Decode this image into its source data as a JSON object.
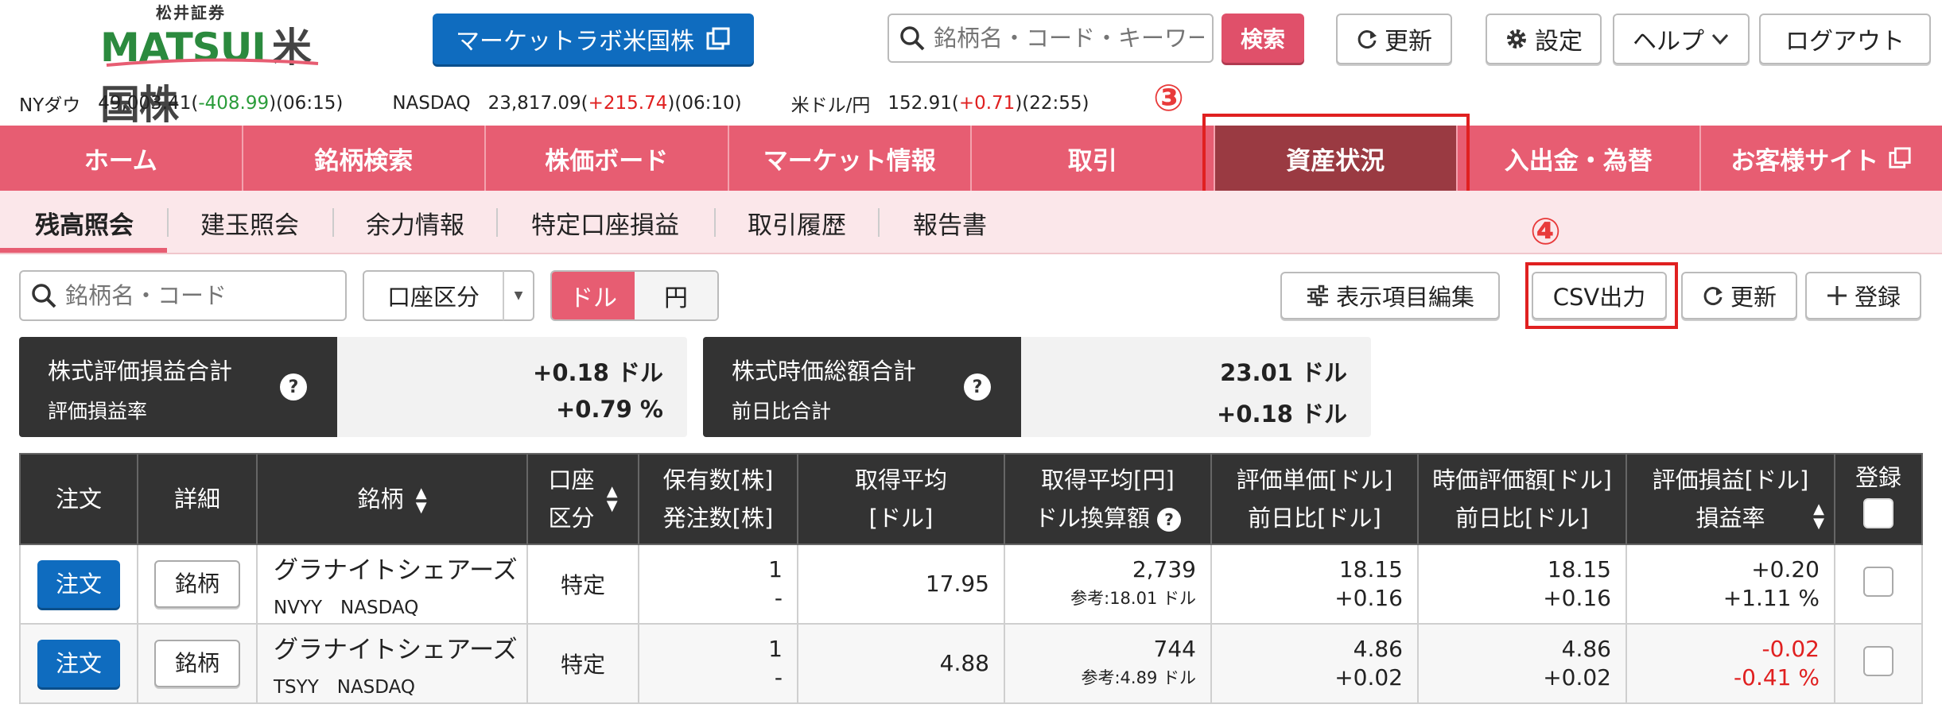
{
  "header": {
    "logo_small": "松井証券",
    "logo_brand": "MATSUI",
    "logo_sub": "米国株",
    "lab_button": "マーケットラボ米国株",
    "search_placeholder": "銘柄名・コード・キーワード",
    "search_button": "検索",
    "refresh_button": "更新",
    "settings_button": "設定",
    "help_button": "ヘルプ",
    "logout_button": "ログアウト"
  },
  "ticker": {
    "dow_label": "NYダウ",
    "dow_value": "49,003.41",
    "dow_change": "-408.99",
    "dow_time": "(06:15)",
    "nasdaq_label": "NASDAQ",
    "nasdaq_value": "23,817.09",
    "nasdaq_change": "+215.74",
    "nasdaq_time": "(06:10)",
    "usdjpy_label": "米ドル/円",
    "usdjpy_value": "152.91",
    "usdjpy_change": "+0.71",
    "usdjpy_time": "(22:55)"
  },
  "annotations": {
    "step3": "③",
    "step4": "④"
  },
  "mainnav": [
    "ホーム",
    "銘柄検索",
    "株価ボード",
    "マーケット情報",
    "取引",
    "資産状況",
    "入出金・為替",
    "お客様サイト"
  ],
  "subnav": [
    "残高照会",
    "建玉照会",
    "余力情報",
    "特定口座損益",
    "取引履歴",
    "報告書"
  ],
  "toolbar": {
    "filter_placeholder": "銘柄名・コード",
    "account_select": "口座区分",
    "currency_usd": "ドル",
    "currency_jpy": "円",
    "edit_columns": "表示項目編集",
    "csv": "CSV出力",
    "refresh": "更新",
    "register": "登録"
  },
  "summary": {
    "card1_label1": "株式評価損益合計",
    "card1_label2": "評価損益率",
    "card1_value1": "+0.18 ドル",
    "card1_value2": "+0.79 %",
    "card2_label1": "株式時価総額合計",
    "card2_label2": "前日比合計",
    "card2_value1": "23.01 ドル",
    "card2_value2": "+0.18 ドル",
    "help": "?"
  },
  "table": {
    "headers": {
      "order": "注文",
      "detail": "詳細",
      "name": "銘柄",
      "account_1": "口座",
      "account_2": "区分",
      "qty_1": "保有数[株]",
      "qty_2": "発注数[株]",
      "avg_1": "取得平均",
      "avg_2": "[ドル]",
      "avgjpy_1": "取得平均[円]",
      "avgjpy_2": "ドル換算額",
      "price_1": "評価単価[ドル]",
      "price_2": "前日比[ドル]",
      "mv_1": "時価評価額[ドル]",
      "mv_2": "前日比[ドル]",
      "pl_1": "評価損益[ドル]",
      "pl_2": "損益率",
      "register": "登録"
    },
    "rows": [
      {
        "order": "注文",
        "detail": "銘柄",
        "name": "グラナイトシェアーズ",
        "ticker": "NVYY　NASDAQ",
        "account": "特定",
        "qty": "1",
        "pending": "-",
        "avg": "17.95",
        "avg_jpy": "2,739",
        "avg_ref": "参考:18.01 ドル",
        "price": "18.15",
        "price_chg": "+0.16",
        "mv": "18.15",
        "mv_chg": "+0.16",
        "pl": "+0.20",
        "pl_rate": "+1.11 %"
      },
      {
        "order": "注文",
        "detail": "銘柄",
        "name": "グラナイトシェアーズ",
        "ticker": "TSYY　NASDAQ",
        "account": "特定",
        "qty": "1",
        "pending": "-",
        "avg": "4.88",
        "avg_jpy": "744",
        "avg_ref": "参考:4.89 ドル",
        "price": "4.86",
        "price_chg": "+0.02",
        "mv": "4.86",
        "mv_chg": "+0.02",
        "pl": "-0.02",
        "pl_rate": "-0.41 %"
      }
    ]
  },
  "colors": {
    "nav_pink": "#e75d72",
    "nav_active": "#9a3a42",
    "primary_blue": "#0f6cbf",
    "positive_red": "#e02020",
    "negative_green": "#2a9c3a",
    "annotation_red": "#e83a3a"
  },
  "icons": {
    "external_link": "external-link-icon",
    "search": "search-icon",
    "refresh": "refresh-icon",
    "settings": "gear-icon",
    "chevron": "chevron-down-icon",
    "sliders": "sliders-icon",
    "plus": "plus-icon"
  }
}
